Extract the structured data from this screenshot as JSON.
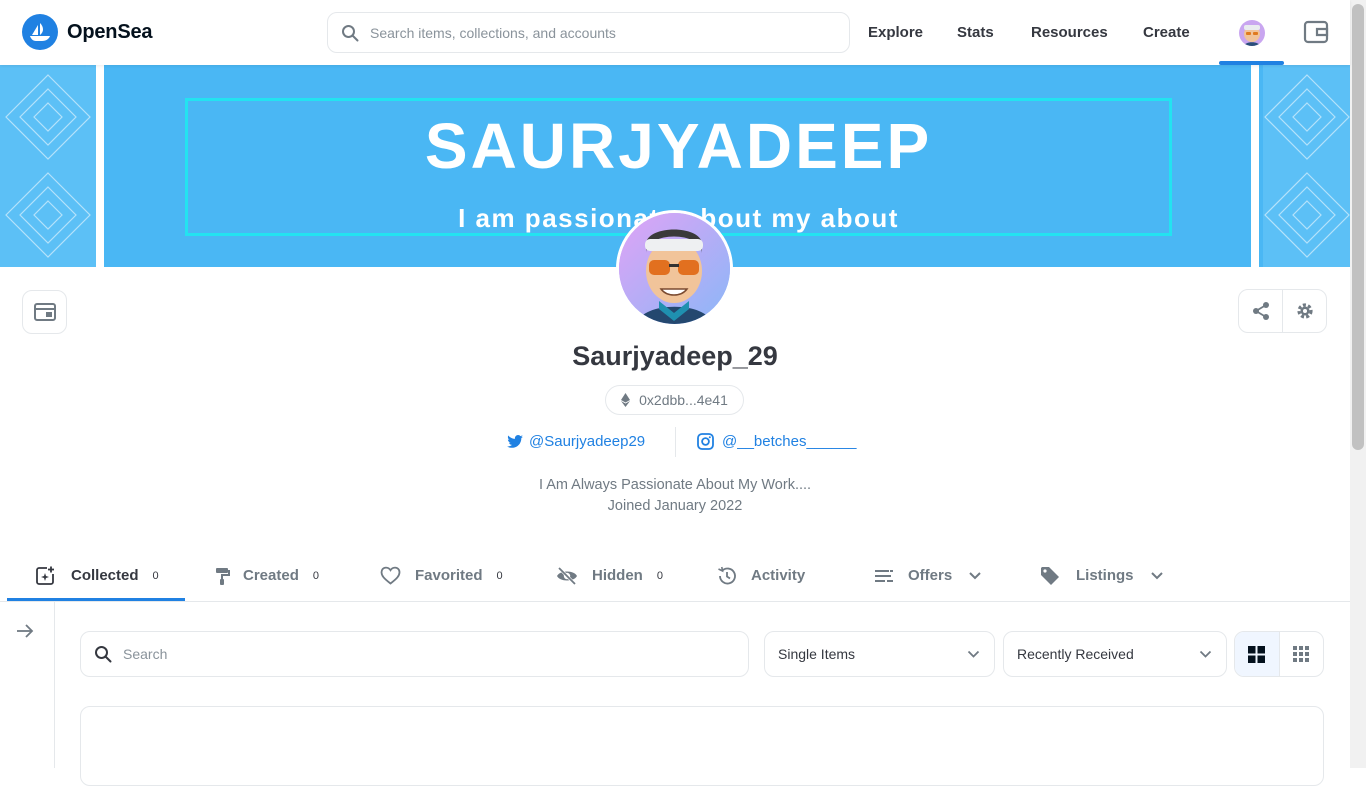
{
  "header": {
    "brand": "OpenSea",
    "search_placeholder": "Search items, collections, and accounts",
    "nav": [
      "Explore",
      "Stats",
      "Resources",
      "Create"
    ]
  },
  "banner": {
    "title": "SAURJYADEEP",
    "subtitle": "I am passionate about my about"
  },
  "profile": {
    "username": "Saurjyadeep_29",
    "address": "0x2dbb...4e41",
    "twitter": "@Saurjyadeep29",
    "instagram": "@__betches______",
    "bio": "I Am Always Passionate About My Work....",
    "joined": "Joined January 2022"
  },
  "tabs": [
    {
      "label": "Collected",
      "count": "0"
    },
    {
      "label": "Created",
      "count": "0"
    },
    {
      "label": "Favorited",
      "count": "0"
    },
    {
      "label": "Hidden",
      "count": "0"
    },
    {
      "label": "Activity"
    },
    {
      "label": "Offers"
    },
    {
      "label": "Listings"
    }
  ],
  "filters": {
    "search_placeholder": "Search",
    "item_type": "Single Items",
    "sort": "Recently Received"
  },
  "colors": {
    "accent": "#2081e2",
    "banner": "#4ab7f4",
    "banner_frame": "#23e3f0"
  }
}
